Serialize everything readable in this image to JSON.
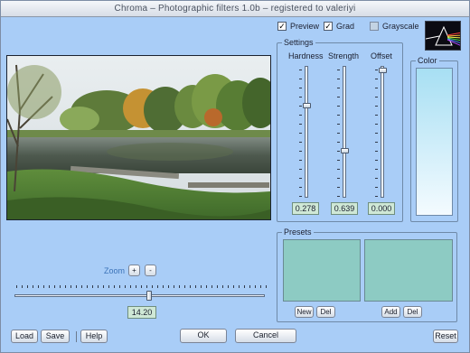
{
  "window": {
    "title": "Chroma – Photographic filters 1.0b – registered to valeriyi"
  },
  "options": {
    "preview": {
      "label": "Preview",
      "checked": true
    },
    "grad": {
      "label": "Grad",
      "checked": true
    },
    "grayscale": {
      "label": "Grayscale",
      "checked": false
    }
  },
  "settings": {
    "title": "Settings",
    "hardness": {
      "label": "Hardness",
      "value": "0.278",
      "level": 0.278
    },
    "strength": {
      "label": "Strength",
      "value": "0.639",
      "level": 0.639
    },
    "offset": {
      "label": "Offset",
      "value": "0.000",
      "level": 0.0
    }
  },
  "color": {
    "title": "Color",
    "top": "#a7dff3",
    "bottom": "#f4fbff"
  },
  "presets": {
    "title": "Presets",
    "new_label": "New",
    "del_label": "Del",
    "add_label": "Add",
    "del2_label": "Del"
  },
  "zoom": {
    "label": "Zoom",
    "plus": "+",
    "minus": "-",
    "value": "14.20",
    "level": 0.54
  },
  "buttons": {
    "load": "Load",
    "save": "Save",
    "help": "Help",
    "ok": "OK",
    "cancel": "Cancel",
    "reset": "Reset"
  },
  "colors": {
    "window_bg": "#a9cdf7",
    "preset_fill": "#8dcbc3",
    "value_fill": "#cfe8d6"
  },
  "icons": {
    "logo": "prism-rainbow-icon",
    "check": "checkmark-icon"
  }
}
